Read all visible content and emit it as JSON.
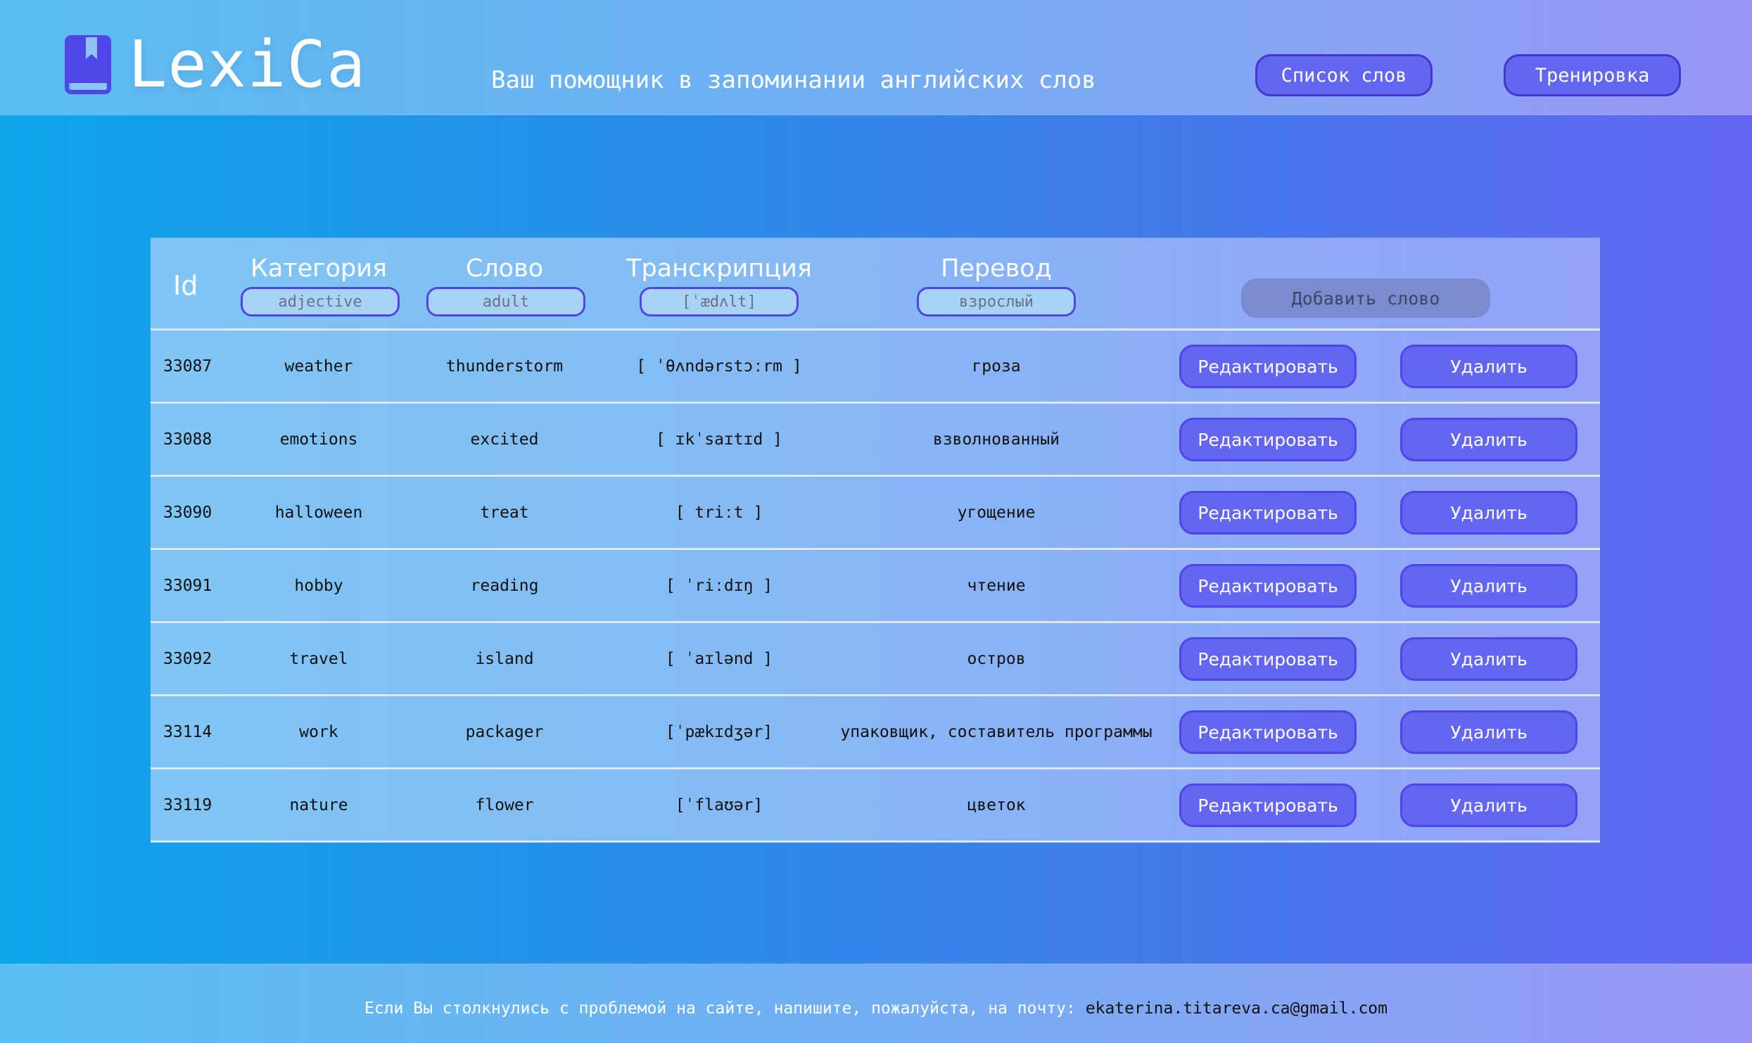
{
  "header": {
    "logo_text": "LexiCa",
    "logo_icon": "book-icon",
    "tagline": "Ваш помощник в запоминании английских слов",
    "nav": {
      "words_label": "Список слов",
      "training_label": "Тренировка"
    }
  },
  "table": {
    "columns": {
      "id": "Id",
      "category": {
        "label": "Категория",
        "placeholder": "adjective"
      },
      "word": {
        "label": "Слово",
        "placeholder": "adult"
      },
      "transcription": {
        "label": "Транскрипция",
        "placeholder": "[ˈædʌlt]"
      },
      "translation": {
        "label": "Перевод",
        "placeholder": "взрослый"
      }
    },
    "add_button": "Добавить слово",
    "edit_label": "Редактировать",
    "delete_label": "Удалить",
    "rows": [
      {
        "id": "33087",
        "category": "weather",
        "word": "thunderstorm",
        "transcription": "[ ˈθʌndərstɔːrm ]",
        "translation": "гроза"
      },
      {
        "id": "33088",
        "category": "emotions",
        "word": "excited",
        "transcription": "[ ɪkˈsaɪtɪd ]",
        "translation": "взволнованный"
      },
      {
        "id": "33090",
        "category": "halloween",
        "word": "treat",
        "transcription": "[ triːt ]",
        "translation": "угощение"
      },
      {
        "id": "33091",
        "category": "hobby",
        "word": "reading",
        "transcription": "[ ˈriːdɪŋ ]",
        "translation": "чтение"
      },
      {
        "id": "33092",
        "category": "travel",
        "word": "island",
        "transcription": "[ ˈaɪlənd ]",
        "translation": "остров"
      },
      {
        "id": "33114",
        "category": "work",
        "word": "packager",
        "transcription": "[ˈpækɪdʒər]",
        "translation": "упаковщик, составитель программы"
      },
      {
        "id": "33119",
        "category": "nature",
        "word": "flower",
        "transcription": "[ˈflaʊər]",
        "translation": "цветок"
      }
    ]
  },
  "footer": {
    "text": "Если Вы столкнулись с проблемой на сайте, напишите, пожалуйста, на почту: ",
    "email": "ekaterina.titareva.ca@gmail.com"
  },
  "colors": {
    "accent": "#6366f1",
    "accent_border": "#4f46e5",
    "header_bg": "#6fb0f2",
    "add_button_bg": "#7b8bcf"
  }
}
